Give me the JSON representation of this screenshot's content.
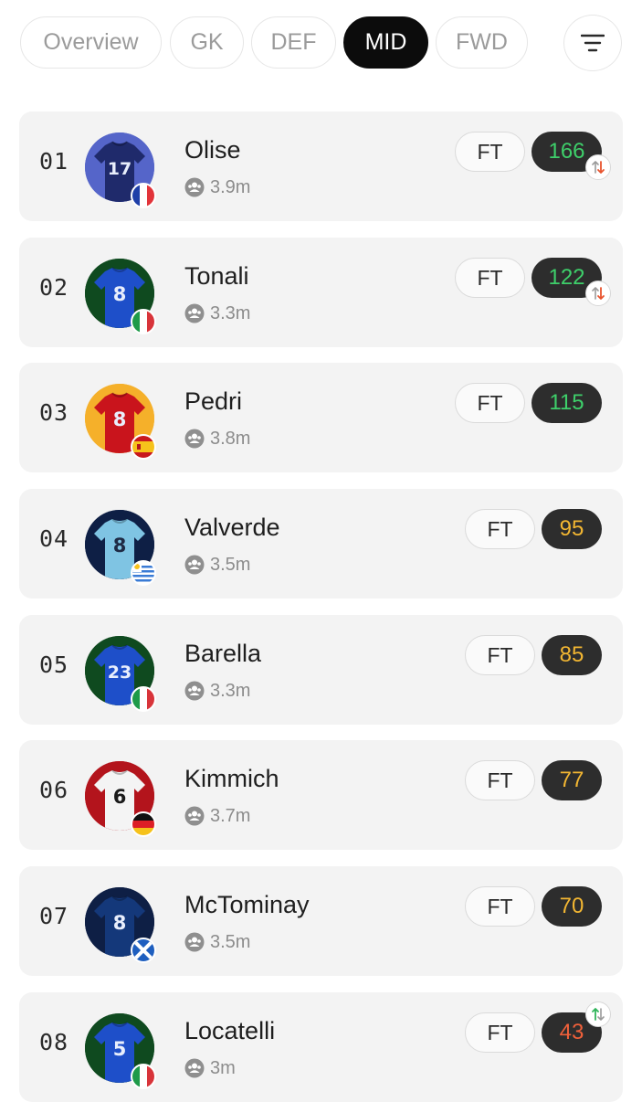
{
  "tabs": [
    {
      "label": "Overview",
      "active": false
    },
    {
      "label": "GK",
      "active": false
    },
    {
      "label": "DEF",
      "active": false
    },
    {
      "label": "MID",
      "active": true
    },
    {
      "label": "FWD",
      "active": false
    }
  ],
  "filter": {
    "icon": "filter-icon"
  },
  "colors": {
    "score_high": "#3ecf6a",
    "score_mid": "#f2b632",
    "score_low": "#f0603a",
    "trend_down": "#e8532e",
    "trend_up": "#2fb45a"
  },
  "players": [
    {
      "rank": "01",
      "name": "Olise",
      "owners": "3.9m",
      "fixture": "FT",
      "score": "166",
      "score_tier": "high",
      "trend": "swap-down",
      "shirt_number": "17",
      "shirt_color": "#1f2a6b",
      "ring_color": "#5565c9",
      "flag": "france"
    },
    {
      "rank": "02",
      "name": "Tonali",
      "owners": "3.3m",
      "fixture": "FT",
      "score": "122",
      "score_tier": "high",
      "trend": "swap-down",
      "shirt_number": "8",
      "shirt_color": "#1e4fc9",
      "ring_color": "#0f4a1f",
      "flag": "italy"
    },
    {
      "rank": "03",
      "name": "Pedri",
      "owners": "3.8m",
      "fixture": "FT",
      "score": "115",
      "score_tier": "high",
      "trend": "",
      "shirt_number": "8",
      "shirt_color": "#c9141c",
      "ring_color": "#f5b02a",
      "flag": "spain"
    },
    {
      "rank": "04",
      "name": "Valverde",
      "owners": "3.5m",
      "fixture": "FT",
      "score": "95",
      "score_tier": "mid",
      "trend": "",
      "shirt_number": "8",
      "shirt_color": "#7fc4e3",
      "ring_color": "#0e1f45",
      "flag": "uruguay"
    },
    {
      "rank": "05",
      "name": "Barella",
      "owners": "3.3m",
      "fixture": "FT",
      "score": "85",
      "score_tier": "mid",
      "trend": "",
      "shirt_number": "23",
      "shirt_color": "#1e4fc9",
      "ring_color": "#0f4a1f",
      "flag": "italy"
    },
    {
      "rank": "06",
      "name": "Kimmich",
      "owners": "3.7m",
      "fixture": "FT",
      "score": "77",
      "score_tier": "mid",
      "trend": "",
      "shirt_number": "6",
      "shirt_color": "#f4f4f4",
      "ring_color": "#b3141c",
      "flag": "germany"
    },
    {
      "rank": "07",
      "name": "McTominay",
      "owners": "3.5m",
      "fixture": "FT",
      "score": "70",
      "score_tier": "mid",
      "trend": "",
      "shirt_number": "8",
      "shirt_color": "#14387a",
      "ring_color": "#0e1f45",
      "flag": "scotland"
    },
    {
      "rank": "08",
      "name": "Locatelli",
      "owners": "3m",
      "fixture": "FT",
      "score": "43",
      "score_tier": "low",
      "trend": "swap-up",
      "shirt_number": "5",
      "shirt_color": "#1e4fc9",
      "ring_color": "#0f4a1f",
      "flag": "italy"
    }
  ]
}
